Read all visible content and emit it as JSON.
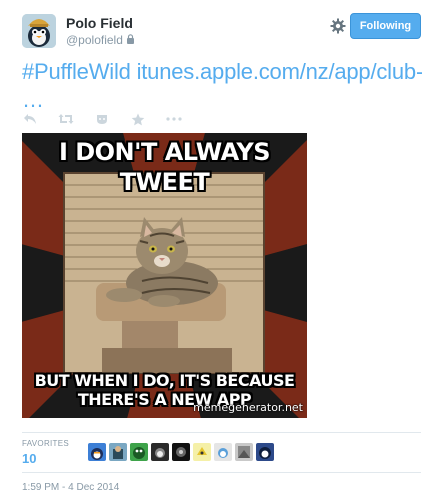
{
  "user": {
    "display_name": "Polo Field",
    "handle": "@polofield",
    "protected_icon": "lock-icon"
  },
  "header": {
    "settings_icon": "gear-icon",
    "follow_label": "Following"
  },
  "tweet": {
    "hashtag_link": "#PuffleWild itunes.apple.com/nz/app/club-pe",
    "ellipsis": "…"
  },
  "actions": [
    "reply-icon",
    "retweet-icon",
    "favorite-icon",
    "star-icon",
    "more-icon"
  ],
  "media": {
    "top_caption_line1": "I DON'T ALWAYS",
    "top_caption_line2": "TWEET",
    "bottom_caption_line1": "BUT WHEN I DO, IT'S BECAUSE",
    "bottom_caption_line2": "THERE'S A NEW APP",
    "watermark": "memegenerator.net"
  },
  "stats": {
    "label": "FAVORITES",
    "count": "10"
  },
  "timestamp": "1:59 PM - 4 Dec 2014",
  "colors": {
    "accent": "#55acee",
    "text": "#292f33",
    "muted": "#8899a6",
    "divider": "#e1e8ed"
  }
}
